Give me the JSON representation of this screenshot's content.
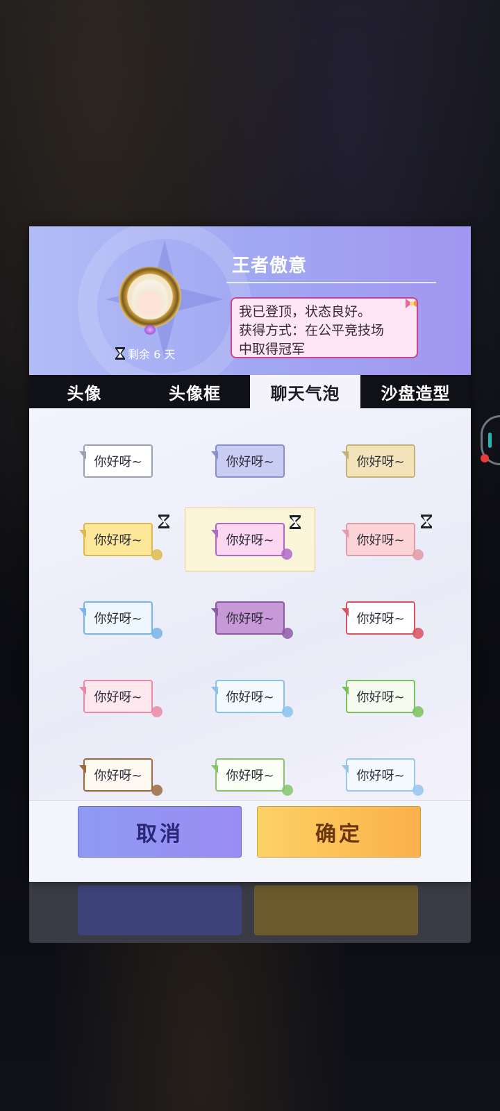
{
  "profile": {
    "name": "王者傲意",
    "remaining_label": "剩余 6 天",
    "bubble_desc_line1": "我已登顶，状态良好。",
    "bubble_desc_line2": "获得方式：在公平竞技场",
    "bubble_desc_line3": "中取得冠军"
  },
  "tabs": [
    {
      "label": "头像"
    },
    {
      "label": "头像框"
    },
    {
      "label": "聊天气泡",
      "active": true
    },
    {
      "label": "沙盘造型"
    }
  ],
  "bubbles": {
    "sample_text": "你好呀~",
    "items": [
      {
        "id": "plain-white",
        "fill": "#ffffff",
        "border": "#9aa0b4"
      },
      {
        "id": "lavender",
        "fill": "#c9cdf3",
        "border": "#8a90c9"
      },
      {
        "id": "beige",
        "fill": "#f2e3b9",
        "border": "#c6b07a"
      },
      {
        "id": "yellow-timed",
        "fill": "#fde899",
        "border": "#e0b94c",
        "timed": true
      },
      {
        "id": "pink-purple-timed",
        "fill": "#fbd7f2",
        "border": "#b069c9",
        "timed": true,
        "selected": true
      },
      {
        "id": "peach-timed",
        "fill": "#fcd3d6",
        "border": "#e39aa6",
        "timed": true
      },
      {
        "id": "ice",
        "fill": "#eef6ff",
        "border": "#7ab4e8"
      },
      {
        "id": "purple-chess",
        "fill": "#c799d6",
        "border": "#8e5aa6"
      },
      {
        "id": "red-badge",
        "fill": "#ffffff",
        "border": "#d9535f"
      },
      {
        "id": "pink-rose",
        "fill": "#fde7ee",
        "border": "#ec8aa6"
      },
      {
        "id": "winter-blue",
        "fill": "#f3f9ff",
        "border": "#89c3ec"
      },
      {
        "id": "green-castle",
        "fill": "#f5fbef",
        "border": "#79c25b"
      },
      {
        "id": "wood-magnifier",
        "fill": "#fffaf1",
        "border": "#9a6a3c"
      },
      {
        "id": "rainbow-bunny",
        "fill": "#fbfff5",
        "border": "#88c46c"
      },
      {
        "id": "sky-chest",
        "fill": "#f4faff",
        "border": "#96c5ee"
      }
    ]
  },
  "footer": {
    "cancel_label": "取消",
    "confirm_label": "确定"
  }
}
